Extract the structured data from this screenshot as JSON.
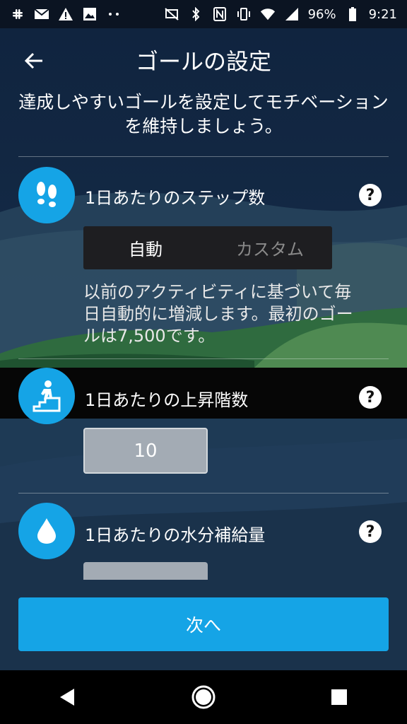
{
  "status_bar": {
    "battery": "96%",
    "time": "9:21",
    "left_icons": [
      "slack-icon",
      "gmail-icon",
      "warning-icon",
      "image-icon",
      "more-dots-icon"
    ],
    "right_icons": [
      "wireless-charging-off-icon",
      "bluetooth-icon",
      "nfc-icon",
      "vibrate-icon",
      "wifi-icon",
      "signal-icon",
      "battery-icon"
    ]
  },
  "header": {
    "title": "ゴールの設定"
  },
  "subtitle": "達成しやすいゴールを設定してモチベーションを維持しましょう。",
  "steps": {
    "icon": "footprints-icon",
    "label": "1日あたりのステップ数",
    "segment": {
      "auto": "自動",
      "custom": "カスタム",
      "selected": "auto"
    },
    "description": "以前のアクティビティに基づいて毎日自動的に増減します。最初のゴールは7,500です。"
  },
  "floors": {
    "icon": "stairs-icon",
    "label": "1日あたりの上昇階数",
    "value": "10"
  },
  "water": {
    "icon": "water-drop-icon",
    "label": "1日あたりの水分補給量"
  },
  "next_button": "次へ",
  "colors": {
    "accent": "#15a4e6",
    "background": "#10203a"
  }
}
